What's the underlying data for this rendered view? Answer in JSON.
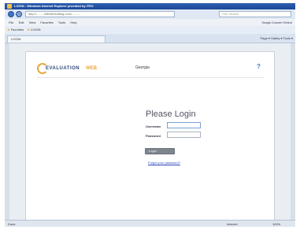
{
  "window": {
    "title": "LOGIN - Windows Internet Explorer provided by ITEX"
  },
  "browser": {
    "address": "http://........./effortresulting.com/..........",
    "search_placeholder": "Live Search",
    "menu": [
      "File",
      "Edit",
      "View",
      "Favorites",
      "Tools",
      "Help"
    ],
    "toolbar_right": "Snagit   Convert   Select",
    "favorites_label": "Favorites",
    "favorite_link": "LOGIN",
    "tab_label": "LOGIN",
    "command_bar": "Page ▾  Safety ▾  Tools ▾"
  },
  "page": {
    "logo_part1": "EVALUATION",
    "logo_part2": "WEB",
    "region": "Georgia",
    "help_icon": "?",
    "login_title": "Please Login",
    "username_label": "Username",
    "password_label": "Password",
    "login_button": "Login",
    "forgot_link": "Forgot your password?"
  },
  "status": {
    "left": "Done",
    "zone": "Internet",
    "zoom": "100%"
  }
}
